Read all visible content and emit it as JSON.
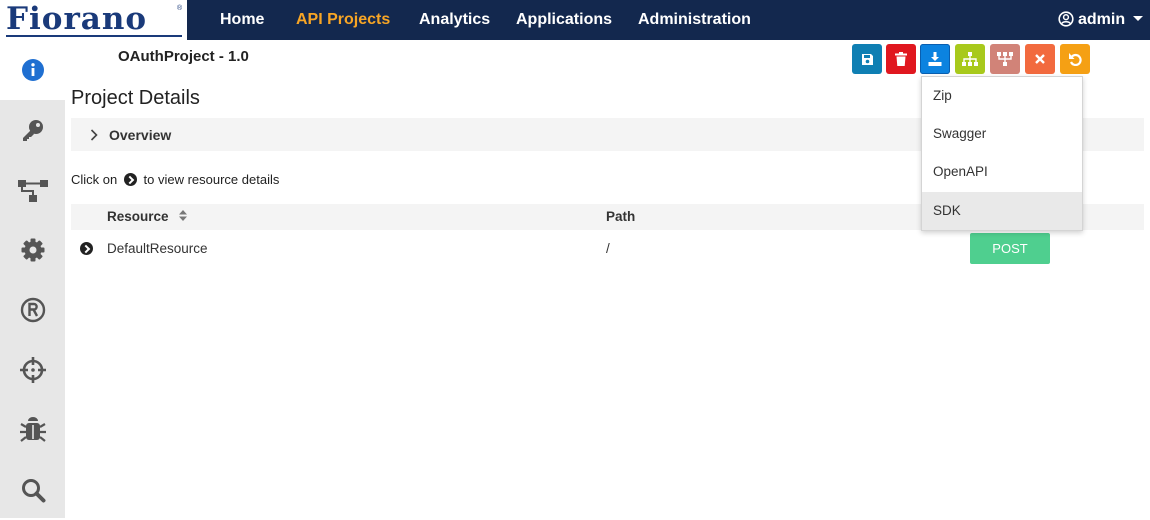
{
  "brand": {
    "name": "Fiorano",
    "registered_mark": "®"
  },
  "nav": {
    "items": [
      {
        "label": "Home",
        "active": false
      },
      {
        "label": "API Projects",
        "active": true
      },
      {
        "label": "Analytics",
        "active": false
      },
      {
        "label": "Applications",
        "active": false
      },
      {
        "label": "Administration",
        "active": false
      }
    ],
    "user": {
      "label": "admin",
      "icon": "user-circle-icon"
    }
  },
  "sidebar": {
    "items": [
      {
        "icon": "info-icon",
        "active": true
      },
      {
        "icon": "key-icon",
        "active": false
      },
      {
        "icon": "flow-icon",
        "active": false
      },
      {
        "icon": "gear-icon",
        "active": false
      },
      {
        "icon": "registered-icon",
        "active": false
      },
      {
        "icon": "crosshair-icon",
        "active": false
      },
      {
        "icon": "bug-icon",
        "active": false
      },
      {
        "icon": "search-icon",
        "active": false
      }
    ]
  },
  "project": {
    "title": "OAuthProject - 1.0"
  },
  "section": {
    "title": "Project Details"
  },
  "overview": {
    "label": "Overview"
  },
  "hint": {
    "before": "Click on",
    "after": "to view resource details"
  },
  "table": {
    "columns": [
      {
        "label": "Resource",
        "sortable": true
      },
      {
        "label": "Path",
        "sortable": false
      }
    ],
    "rows": [
      {
        "resource": "DefaultResource",
        "path": "/",
        "method": "POST"
      }
    ]
  },
  "toolbar": {
    "buttons": [
      {
        "icon": "save-icon",
        "color": "#0f7fb3"
      },
      {
        "icon": "trash-icon",
        "color": "#e0171f"
      },
      {
        "icon": "download-icon",
        "color": "#0c83e0"
      },
      {
        "icon": "sitemap-icon",
        "color": "#a8c91c"
      },
      {
        "icon": "hierarchy-icon",
        "color": "#d18378"
      },
      {
        "icon": "close-icon",
        "color": "#f26a3e"
      },
      {
        "icon": "undo-icon",
        "color": "#f5a014"
      }
    ]
  },
  "export_menu": {
    "items": [
      {
        "label": "Zip",
        "highlighted": false
      },
      {
        "label": "Swagger",
        "highlighted": false
      },
      {
        "label": "OpenAPI",
        "highlighted": false
      },
      {
        "label": "SDK",
        "highlighted": true
      }
    ]
  },
  "colors": {
    "navbar": "#13284e",
    "nav_active": "#f7a525",
    "sidebar": "#e7e7e7",
    "sidebar_icon": "#555555",
    "info_icon": "#1f6fd1",
    "post": "#4fcf8f"
  }
}
